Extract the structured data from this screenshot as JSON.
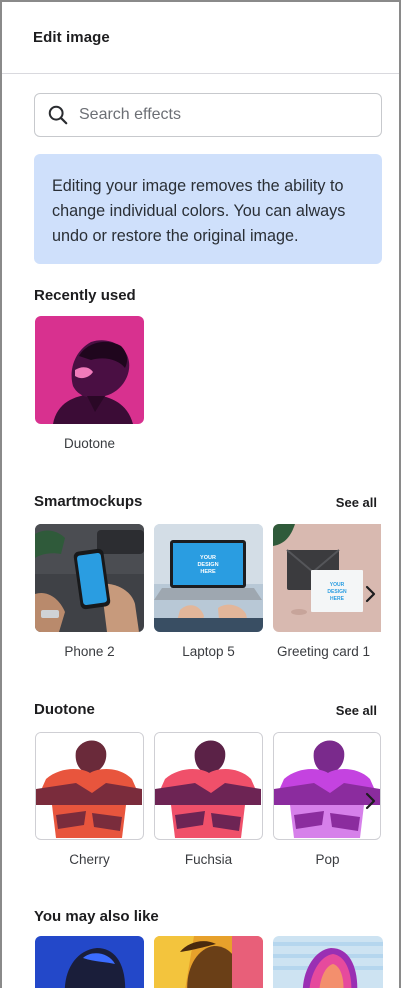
{
  "header": {
    "title": "Edit image"
  },
  "search": {
    "placeholder": "Search effects",
    "value": ""
  },
  "info": {
    "text": "Editing your image removes the ability to change individual colors. You can always undo or restore the original image."
  },
  "recently_used": {
    "title": "Recently used",
    "items": [
      {
        "label": "Duotone"
      }
    ]
  },
  "smartmockups": {
    "title": "Smartmockups",
    "see_all": "See all",
    "items": [
      {
        "label": "Phone 2"
      },
      {
        "label": "Laptop 5",
        "screen_text": "YOUR DESIGN HERE"
      },
      {
        "label": "Greeting card 1",
        "card_text": "YOUR DESIGN HERE"
      }
    ]
  },
  "duotone": {
    "title": "Duotone",
    "see_all": "See all",
    "items": [
      {
        "label": "Cherry"
      },
      {
        "label": "Fuchsia"
      },
      {
        "label": "Pop"
      }
    ]
  },
  "also_like": {
    "title": "You may also like"
  },
  "colors": {
    "accent_blue": "#cfe0fb",
    "duotone_magenta": "#d8318f",
    "cherry_bg": "#e8553d",
    "pop_purple": "#c443e0"
  },
  "icons": {
    "search": "search-icon",
    "chevron": "chevron-right-icon"
  }
}
